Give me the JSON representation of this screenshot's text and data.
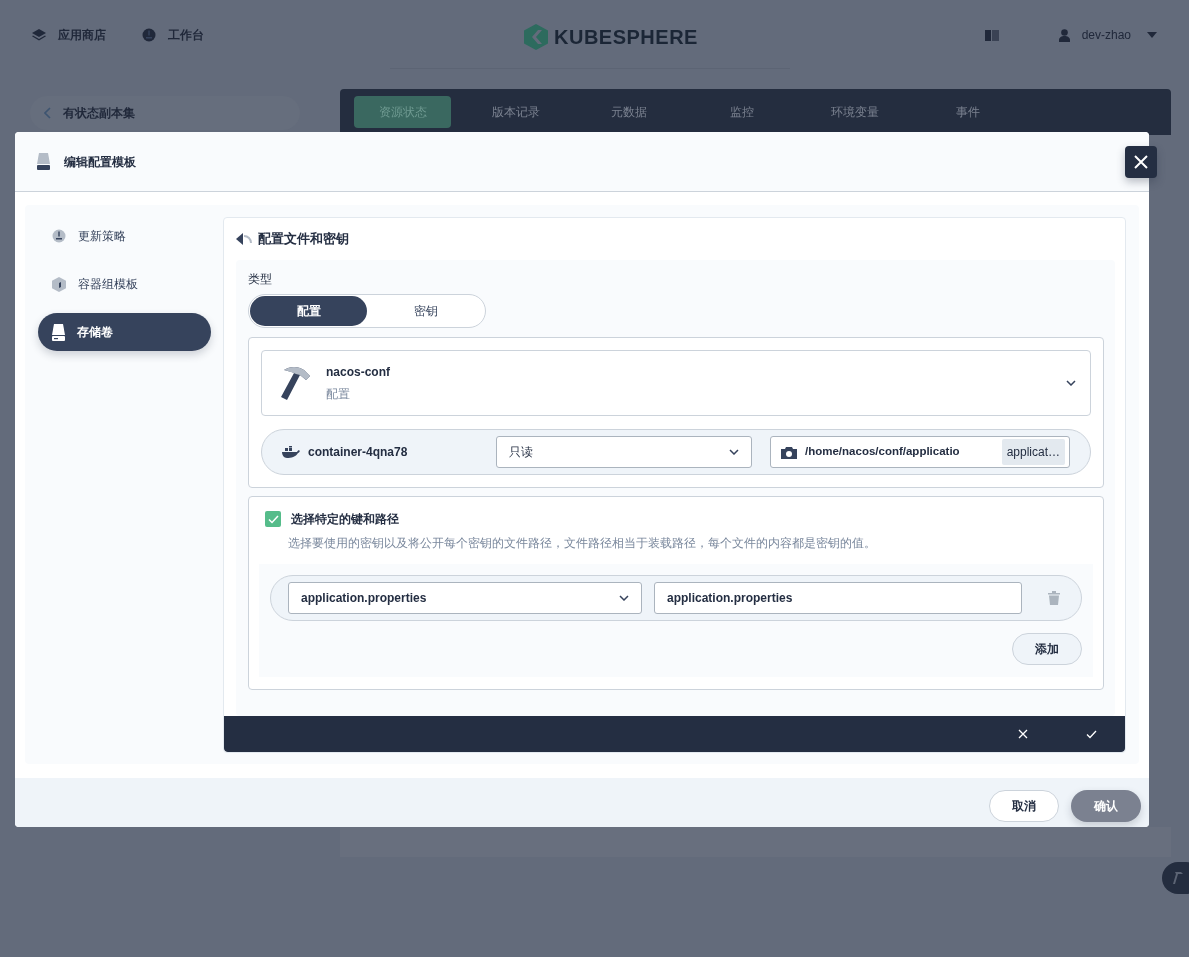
{
  "topbar": {
    "nav": [
      {
        "label": "应用商店",
        "kind": "layers"
      },
      {
        "label": "工作台",
        "kind": "dial"
      }
    ],
    "logo": "KUBESPHERE",
    "user": "dev-zhao"
  },
  "back_link": "有状态副本集",
  "detail_tabs": [
    {
      "label": "资源状态",
      "selected": true
    },
    {
      "label": "版本记录",
      "selected": false
    },
    {
      "label": "元数据",
      "selected": false
    },
    {
      "label": "监控",
      "selected": false
    },
    {
      "label": "环境变量",
      "selected": false
    },
    {
      "label": "事件",
      "selected": false
    }
  ],
  "modal": {
    "title": "编辑配置模板",
    "steps": [
      {
        "label": "更新策略",
        "kind": "dial",
        "selected": false
      },
      {
        "label": "容器组模板",
        "kind": "cube",
        "selected": false
      },
      {
        "label": "存储卷",
        "kind": "disk",
        "selected": true
      }
    ],
    "section_title": "配置文件和密钥",
    "type_label": "类型",
    "type_options": [
      {
        "label": "配置",
        "selected": true
      },
      {
        "label": "密钥",
        "selected": false
      }
    ],
    "resource": {
      "name": "nacos-conf",
      "kind_label": "配置"
    },
    "mount": {
      "container": "container-4qna78",
      "mode": "只读",
      "path": "/home/nacos/conf/applicatio",
      "sub_path": "applicat…"
    },
    "specific_keys": {
      "checked": true,
      "label": "选择特定的键和路径",
      "description": "选择要使用的密钥以及将公开每个密钥的文件路径，文件路径相当于装载路径，每个文件的内容都是密钥的值。"
    },
    "key_rows": [
      {
        "key": "application.properties",
        "path": "application.properties"
      }
    ],
    "add_button": "添加",
    "cancel_button": "取消",
    "confirm_button": "确认"
  }
}
